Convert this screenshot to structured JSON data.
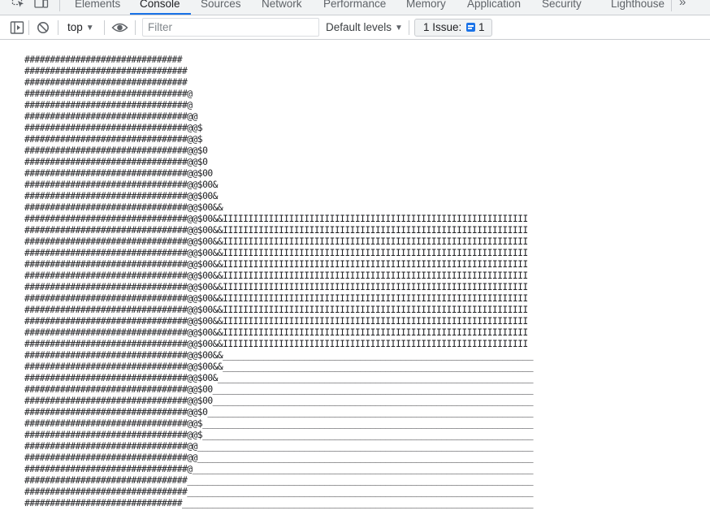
{
  "tabs": [
    {
      "label": "Elements",
      "active": false
    },
    {
      "label": "Console",
      "active": true
    },
    {
      "label": "Sources",
      "active": false
    },
    {
      "label": "Network",
      "active": false
    },
    {
      "label": "Performance",
      "active": false
    },
    {
      "label": "Memory",
      "active": false
    },
    {
      "label": "Application",
      "active": false
    },
    {
      "label": "Security",
      "active": false
    },
    {
      "label": "Lighthouse",
      "active": false
    }
  ],
  "more_tabs_glyph": "»",
  "toolbar": {
    "context_label": "top",
    "context_caret": "▼",
    "filter_placeholder": "Filter",
    "filter_value": "",
    "levels_label": "Default levels",
    "levels_caret": "▼",
    "issues_label": "1 Issue:",
    "issues_count": "1"
  },
  "icons": {
    "inspect": "inspect-element-icon",
    "device": "device-toolbar-icon",
    "sidebar": "show-sidebar-icon",
    "clear": "clear-console-icon",
    "eye": "live-expression-icon",
    "issue": "issue-message-icon"
  },
  "colors": {
    "accent": "#1a73e8",
    "text": "#202124",
    "toolbar_bg": "#f1f3f4",
    "border": "#cacdd1"
  },
  "console_lines": [
    "###############################",
    "################################",
    "################################",
    "################################@",
    "################################@",
    "################################@@",
    "################################@@$",
    "################################@@$",
    "################################@@$0",
    "################################@@$0",
    "################################@@$00",
    "################################@@$00&",
    "################################@@$00&",
    "################################@@$00&&",
    "################################@@$00&&IIIIIIIIIIIIIIIIIIIIIIIIIIIIIIIIIIIIIIIIIIIIIIIIIIIIIIIIIIII",
    "################################@@$00&&IIIIIIIIIIIIIIIIIIIIIIIIIIIIIIIIIIIIIIIIIIIIIIIIIIIIIIIIIIII",
    "################################@@$00&&IIIIIIIIIIIIIIIIIIIIIIIIIIIIIIIIIIIIIIIIIIIIIIIIIIIIIIIIIIII",
    "################################@@$00&&IIIIIIIIIIIIIIIIIIIIIIIIIIIIIIIIIIIIIIIIIIIIIIIIIIIIIIIIIIII",
    "################################@@$00&&IIIIIIIIIIIIIIIIIIIIIIIIIIIIIIIIIIIIIIIIIIIIIIIIIIIIIIIIIIII",
    "################################@@$00&&IIIIIIIIIIIIIIIIIIIIIIIIIIIIIIIIIIIIIIIIIIIIIIIIIIIIIIIIIIII",
    "################################@@$00&&IIIIIIIIIIIIIIIIIIIIIIIIIIIIIIIIIIIIIIIIIIIIIIIIIIIIIIIIIIII",
    "################################@@$00&&IIIIIIIIIIIIIIIIIIIIIIIIIIIIIIIIIIIIIIIIIIIIIIIIIIIIIIIIIIII",
    "################################@@$00&&IIIIIIIIIIIIIIIIIIIIIIIIIIIIIIIIIIIIIIIIIIIIIIIIIIIIIIIIIIII",
    "################################@@$00&&IIIIIIIIIIIIIIIIIIIIIIIIIIIIIIIIIIIIIIIIIIIIIIIIIIIIIIIIIIII",
    "################################@@$00&&IIIIIIIIIIIIIIIIIIIIIIIIIIIIIIIIIIIIIIIIIIIIIIIIIIIIIIIIIIII",
    "################################@@$00&&IIIIIIIIIIIIIIIIIIIIIIIIIIIIIIIIIIIIIIIIIIIIIIIIIIIIIIIIIIII",
    "################################@@$00&&_____________________________________________________________",
    "################################@@$00&&_____________________________________________________________",
    "################################@@$00&______________________________________________________________",
    "################################@@$00_______________________________________________________________",
    "################################@@$00_______________________________________________________________",
    "################################@@$0________________________________________________________________",
    "################################@@$_________________________________________________________________",
    "################################@@$_________________________________________________________________",
    "################################@@__________________________________________________________________",
    "################################@@__________________________________________________________________",
    "################################@___________________________________________________________________",
    "################################____________________________________________________________________",
    "################################____________________________________________________________________",
    "###############################_____________________________________________________________________"
  ]
}
